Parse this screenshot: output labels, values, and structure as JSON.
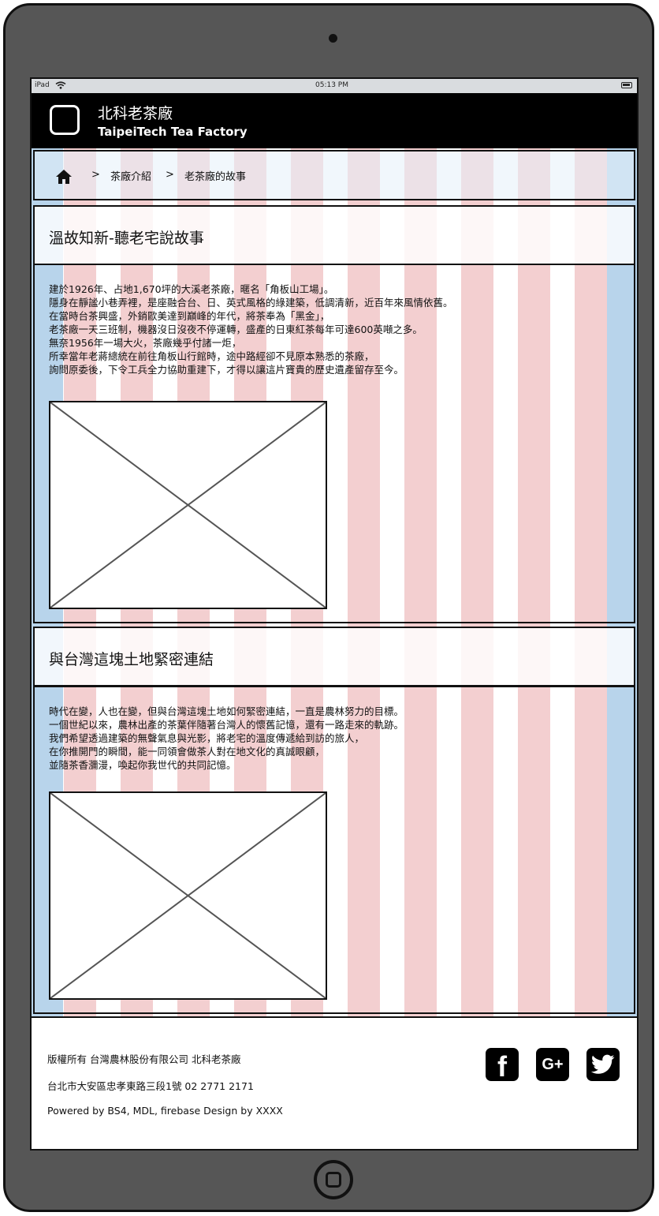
{
  "status_bar": {
    "device": "iPad",
    "time": "05:13 PM"
  },
  "app_bar": {
    "title_zh": "北科老茶廠",
    "title_en": "TaipeiTech Tea Factory"
  },
  "breadcrumb": {
    "separator": ">",
    "items": [
      {
        "label": "茶廠介紹"
      },
      {
        "label": "老茶廠的故事"
      }
    ]
  },
  "sections": [
    {
      "title": "溫故知新-聽老宅說故事",
      "paragraph": [
        "建於1926年、占地1,670坪的大溪老茶廠，暱名「角板山工場」。",
        "隱身在靜謐小巷弄裡，是座融合台、日、英式風格的綠建築，低調清新，近百年來風情依舊。",
        "在當時台茶興盛，外銷歐美達到巔峰的年代，將茶奉為「黑金」，",
        "老茶廠一天三班制，機器沒日沒夜不停運轉，盛產的日東紅茶每年可達600英噸之多。",
        "無奈1956年一場大火，茶廠幾乎付諸一炬，",
        "所幸當年老蔣總統在前往角板山行館時，途中路經卻不見原本熟悉的茶廠，",
        "詢問原委後，下令工兵全力協助重建下，才得以讓這片寶貴的歷史遺產留存至今。"
      ]
    },
    {
      "title": "與台灣這塊土地緊密連結",
      "paragraph": [
        "時代在變，人也在變，但與台灣這塊土地如何緊密連結，一直是農林努力的目標。",
        "一個世紀以來，農林出產的茶葉伴隨著台灣人的懷舊記憶，還有一路走來的軌跡。",
        "我們希望透過建築的無聲氣息與光影，將老宅的溫度傳遞給到訪的旅人，",
        "在你推開門的瞬間，能一同領會做茶人對在地文化的真誠眼顧，",
        "並隨茶香瀰漫，喚起你我世代的共同記憶。"
      ]
    }
  ],
  "footer": {
    "copyright": "版權所有 台灣農林股份有限公司 北科老茶廠",
    "address": "台北市大安區忠孝東路三段1號 02 2771 2171",
    "credits": "Powered by BS4, MDL, firebase Design by XXXX"
  },
  "social": {
    "facebook_glyph": "f",
    "googleplus_glyph": "G+"
  },
  "icons": [
    "home-icon",
    "wifi-icon",
    "battery-icon",
    "facebook-icon",
    "google-plus-icon",
    "twitter-icon",
    "image-placeholder-icon"
  ],
  "colors": {
    "grid_column": "#f3cfd0",
    "grid_gutter": "#b8d4eb",
    "app_bar": "#000000",
    "device": "#565656"
  }
}
